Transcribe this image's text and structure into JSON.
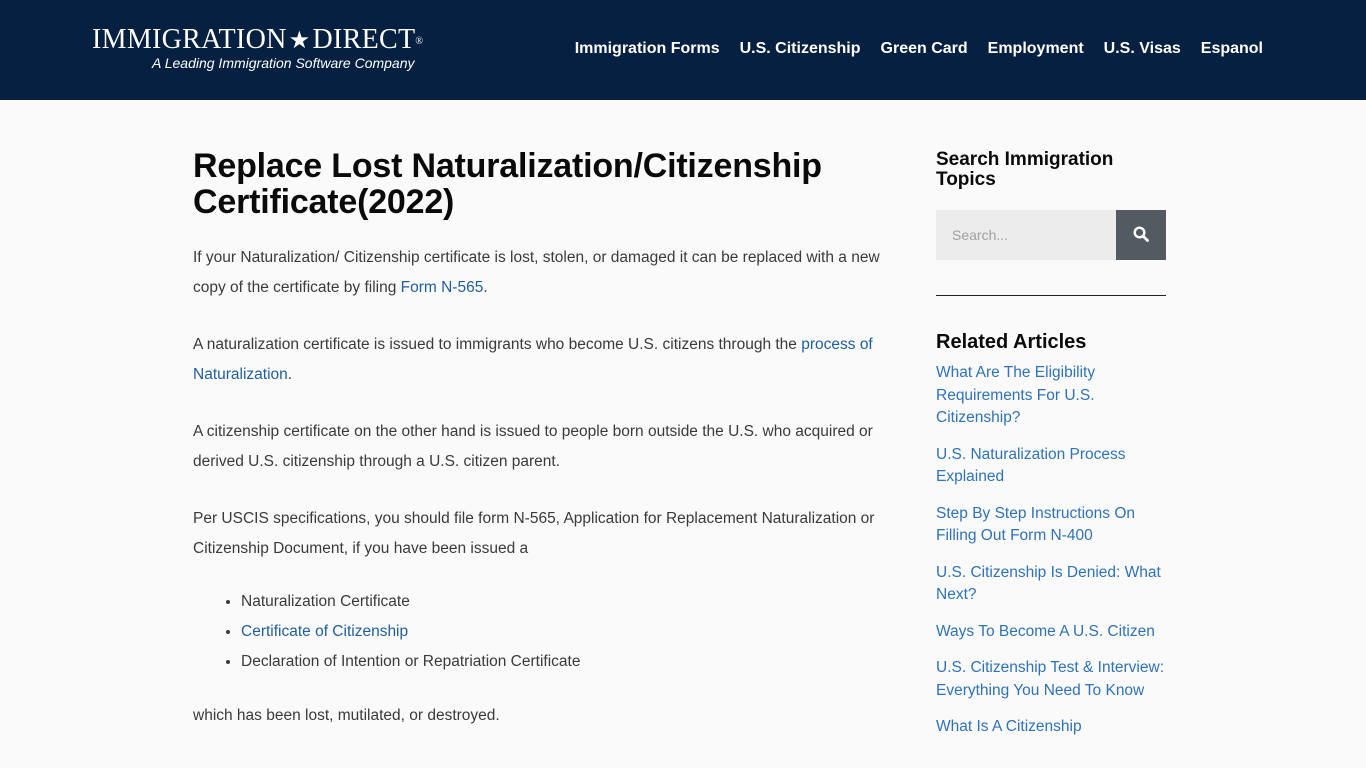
{
  "header": {
    "logo_main_left": "IMMIGRATION",
    "logo_star": "★",
    "logo_main_right": "DIRECT",
    "logo_reg": "®",
    "logo_tagline": "A Leading Immigration Software Company",
    "background": "#062042",
    "nav": [
      {
        "label": "Immigration Forms"
      },
      {
        "label": "U.S. Citizenship"
      },
      {
        "label": "Green Card"
      },
      {
        "label": "Employment"
      },
      {
        "label": "U.S. Visas"
      },
      {
        "label": "Espanol"
      }
    ]
  },
  "article": {
    "title": "Replace Lost Naturalization/Citizenship Certificate(2022)",
    "p1_text": "If your Naturalization/ Citizenship certificate is lost, stolen, or damaged it can be replaced with a new copy of the certificate by filing ",
    "p1_link": "Form N-565",
    "p1_end": ".",
    "p2_text": "A naturalization certificate is issued to immigrants who become U.S. citizens through the ",
    "p2_link": "process of Naturalization",
    "p2_end": ".",
    "p3_text": "A citizenship certificate on the other hand is issued to people born outside the U.S. who acquired or derived U.S. citizenship through a U.S. citizen parent.",
    "p4_text": "Per USCIS specifications, you should file form N-565, Application for Replacement Naturalization or Citizenship Document, if you have been issued a",
    "list": [
      {
        "label": "Naturalization Certificate",
        "link": false
      },
      {
        "label": "Certificate of Citizenship",
        "link": true
      },
      {
        "label": "Declaration of Intention or Repatriation Certificate",
        "link": false
      }
    ],
    "p5_text": "which has been lost, mutilated, or destroyed.",
    "link_color": "#1f5e9c"
  },
  "sidebar": {
    "search_title": "Search Immigration Topics",
    "search_placeholder": "Search...",
    "search_icon": "search-icon",
    "related_title": "Related Articles",
    "related": [
      {
        "label": "What Are The Eligibility Requirements For U.S. Citizenship?"
      },
      {
        "label": "U.S. Naturalization Process Explained"
      },
      {
        "label": "Step By Step Instructions On Filling Out Form N-400"
      },
      {
        "label": "U.S. Citizenship Is Denied: What Next?"
      },
      {
        "label": "Ways To Become A U.S. Citizen"
      },
      {
        "label": "U.S. Citizenship Test & Interview: Everything You Need To Know"
      },
      {
        "label": "What Is A Citizenship"
      }
    ],
    "related_color": "#2f72b7"
  }
}
